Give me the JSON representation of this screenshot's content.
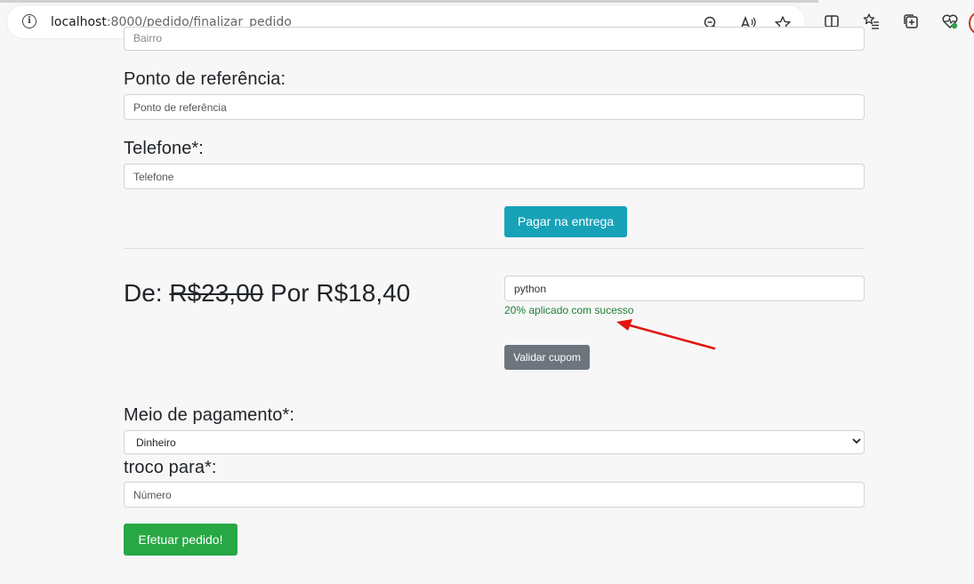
{
  "browser": {
    "url_host": "localhost",
    "url_path": ":8000/pedido/finalizar_pedido",
    "icons": [
      "info-icon",
      "zoom-out-icon",
      "read-aloud-icon",
      "favorite-star-icon",
      "split-screen-icon",
      "favorites-list-icon",
      "collections-icon",
      "browser-essentials-icon",
      "profile-icon"
    ]
  },
  "form": {
    "bairro_placeholder": "Bairro",
    "referencia_label": "Ponto de referência:",
    "referencia_placeholder": "Ponto de referência",
    "telefone_label": "Telefone*:",
    "telefone_placeholder": "Telefone",
    "pagar_entrega_button": "Pagar na entrega"
  },
  "pricing": {
    "de_label": "De:",
    "old_price": "R$23,00",
    "por_label": "Por",
    "new_price": "R$18,40"
  },
  "coupon": {
    "value": "python",
    "feedback": "20% aplicado com sucesso",
    "validate_button": "Validar cupom"
  },
  "payment": {
    "label": "Meio de pagamento*:",
    "selected": "Dinheiro",
    "troco_label": "troco para*:",
    "troco_placeholder": "Número",
    "submit_button": "Efetuar pedido!"
  },
  "colors": {
    "info_button": "#17a2b8",
    "secondary_button": "#6c757d",
    "success_button": "#28a745",
    "success_text": "#1e7e34",
    "annotation_arrow": "#e3140f"
  }
}
